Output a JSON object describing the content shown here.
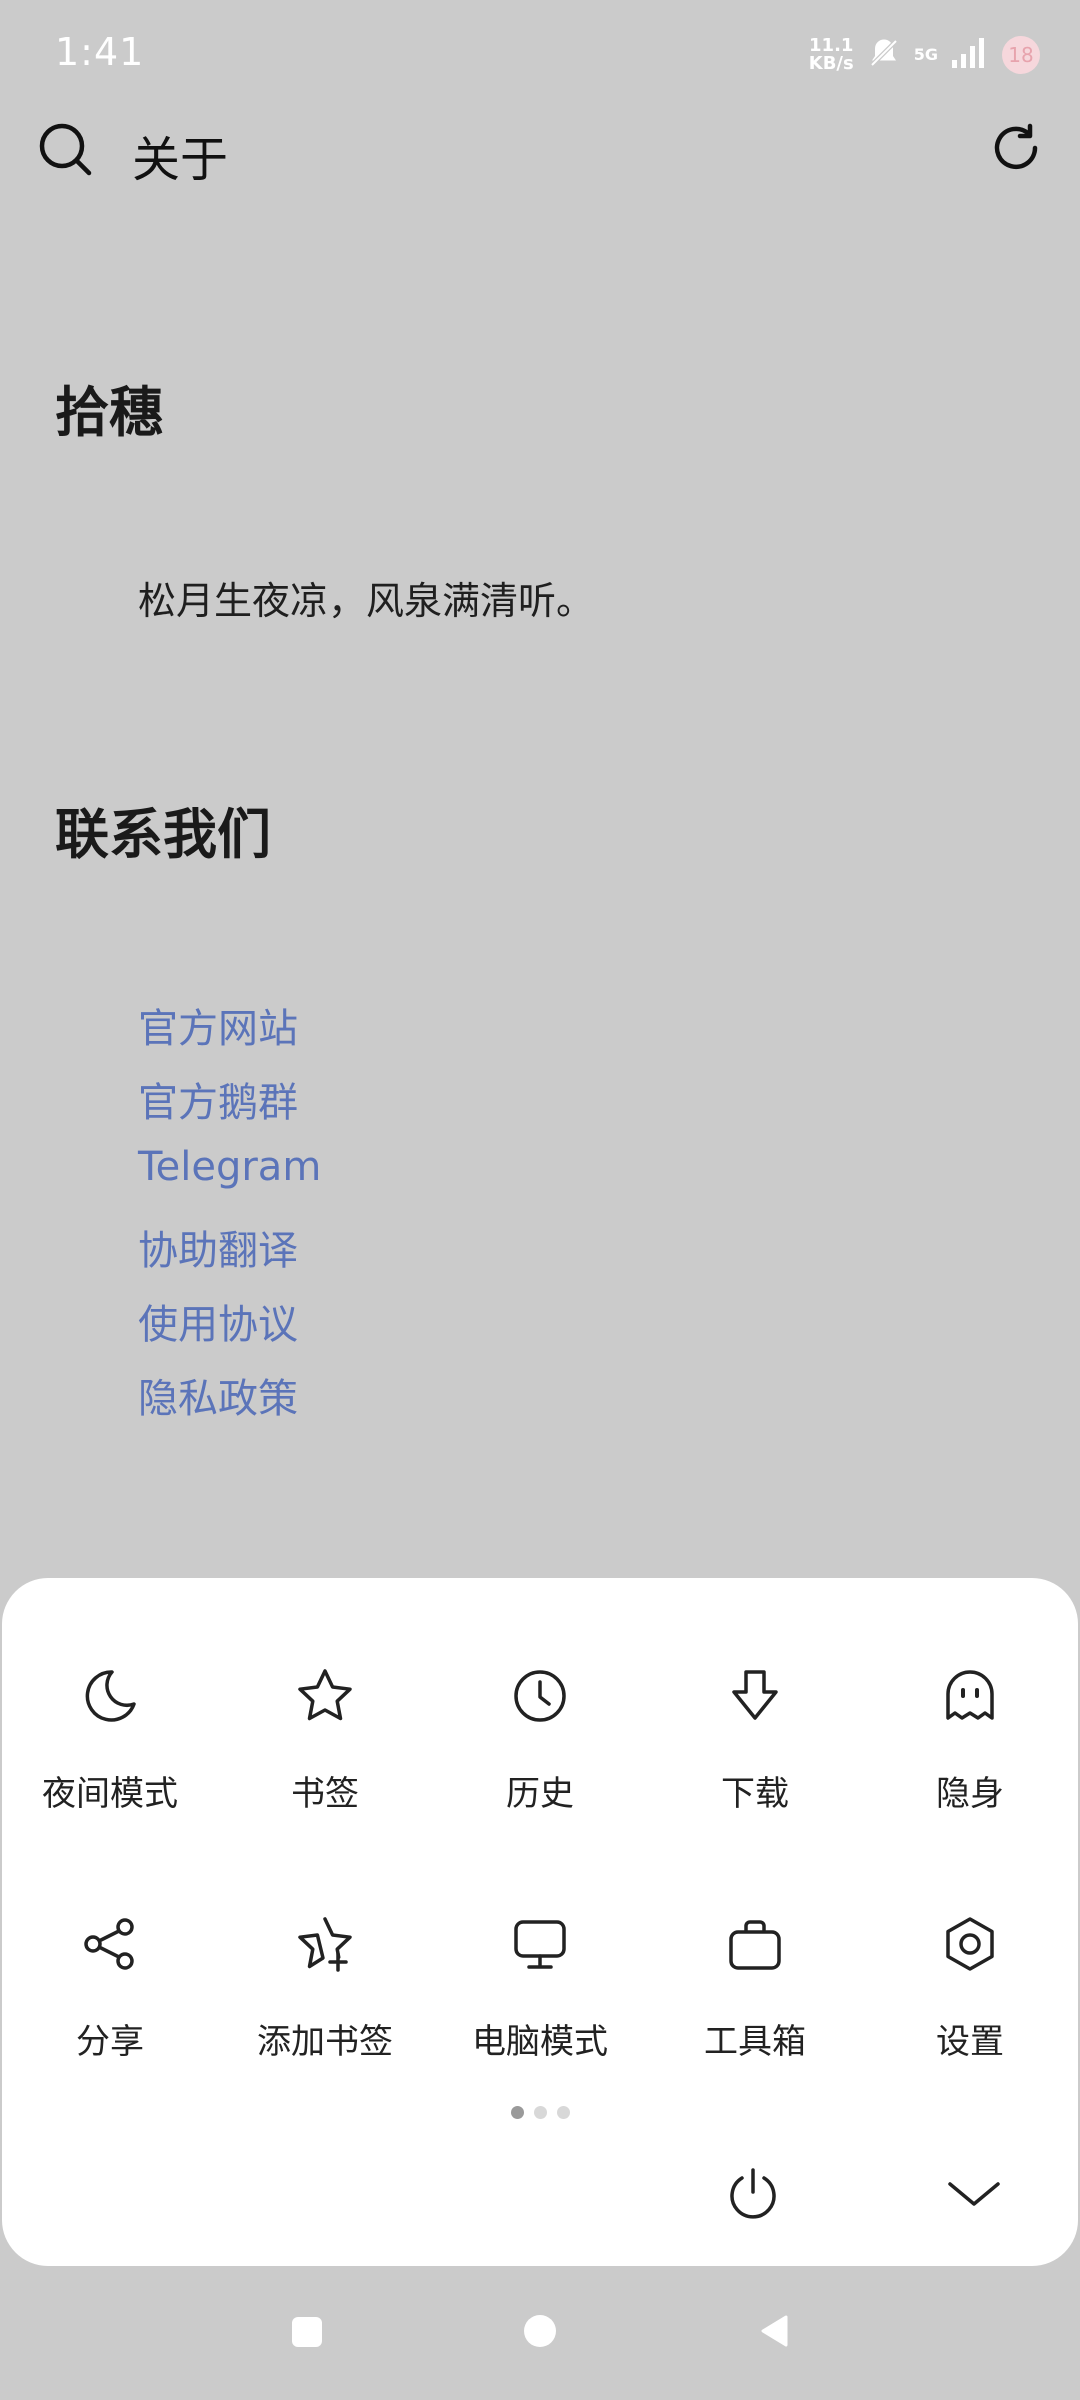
{
  "status_bar": {
    "time": "1:41",
    "net_speed_value": "11.1",
    "net_speed_unit": "KB/s",
    "network": "5G",
    "battery": "18"
  },
  "toolbar": {
    "title": "关于"
  },
  "content": {
    "section1_heading": "拾穗",
    "quote": "松月生夜凉，风泉满清听。",
    "section2_heading": "联系我们",
    "links": [
      "官方网站",
      "官方鹅群",
      "Telegram",
      "协助翻译",
      "使用协议",
      "隐私政策"
    ]
  },
  "menu": {
    "row1": [
      {
        "label": "夜间模式",
        "icon": "moon-icon"
      },
      {
        "label": "书签",
        "icon": "star-icon"
      },
      {
        "label": "历史",
        "icon": "clock-icon"
      },
      {
        "label": "下载",
        "icon": "download-arrow-icon"
      },
      {
        "label": "隐身",
        "icon": "ghost-icon"
      }
    ],
    "row2": [
      {
        "label": "分享",
        "icon": "share-icon"
      },
      {
        "label": "添加书签",
        "icon": "star-plus-icon"
      },
      {
        "label": "电脑模式",
        "icon": "monitor-icon"
      },
      {
        "label": "工具箱",
        "icon": "toolbox-icon"
      },
      {
        "label": "设置",
        "icon": "settings-hex-icon"
      }
    ],
    "page_count": 3,
    "active_page": 1
  },
  "colors": {
    "background": "#cbcbcb",
    "link": "#5b74b9",
    "sheet": "#ffffff"
  }
}
